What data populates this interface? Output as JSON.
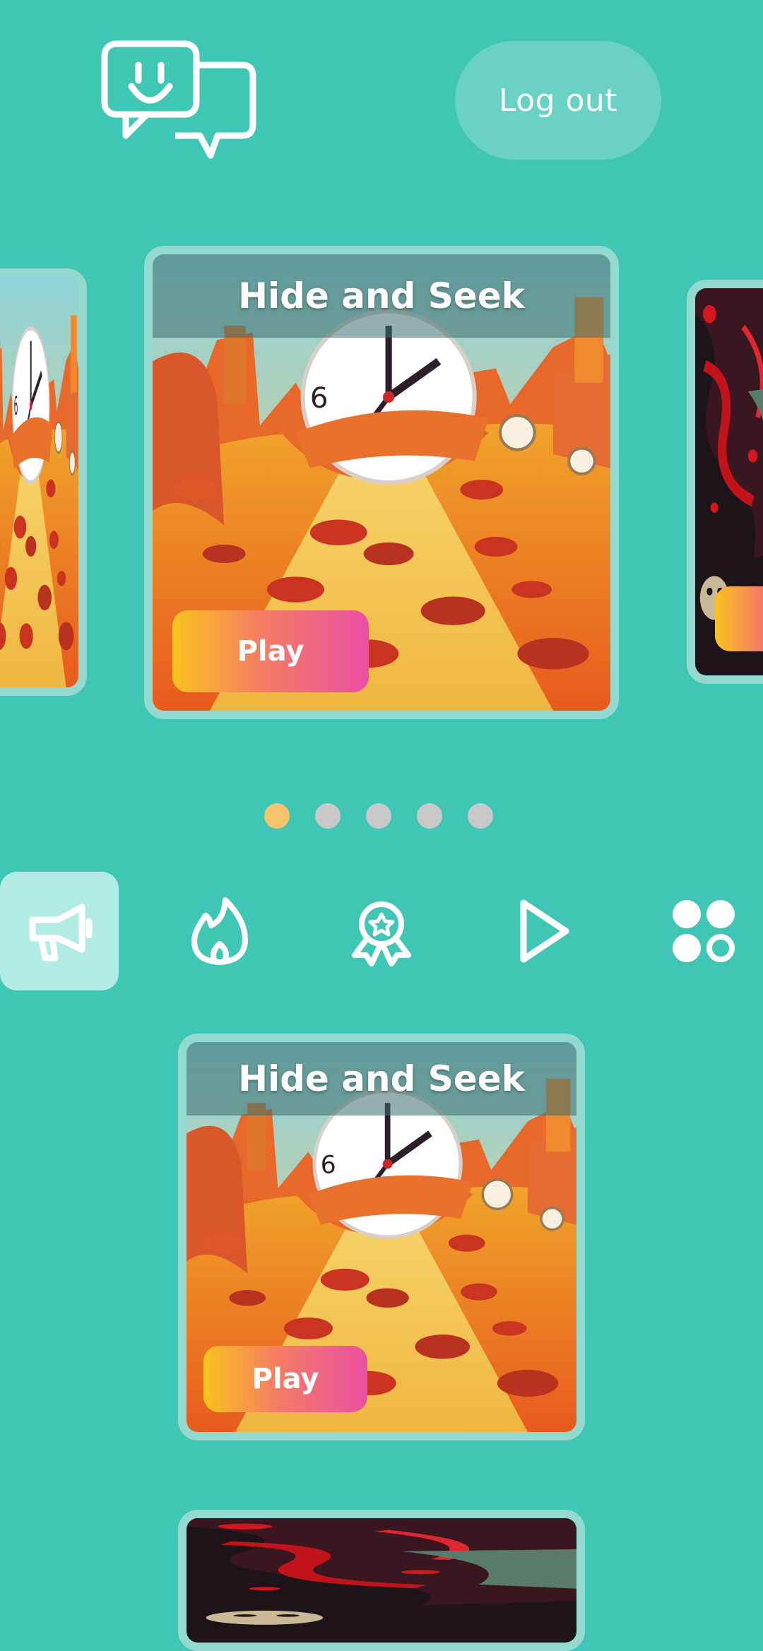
{
  "header": {
    "logo_icon": "chat-bubbles-smiley-icon",
    "logout_label": "Log out"
  },
  "carousel": {
    "cards": [
      {
        "title": "Hide and Seek",
        "play_label": "Play",
        "position": "center"
      },
      {
        "title": "",
        "play_label": "",
        "position": "left-peek"
      },
      {
        "title": "",
        "play_label": "",
        "position": "right-peek"
      }
    ],
    "page_count": 5,
    "active_page": 1
  },
  "tabs": [
    {
      "icon": "megaphone-icon",
      "active": true
    },
    {
      "icon": "flame-icon",
      "active": false
    },
    {
      "icon": "award-badge-icon",
      "active": false
    },
    {
      "icon": "play-icon",
      "active": false
    },
    {
      "icon": "grid-icon",
      "active": false
    }
  ],
  "list": {
    "cards": [
      {
        "title": "Hide and Seek",
        "play_label": "Play"
      }
    ]
  },
  "colors": {
    "background": "#3fc6b5",
    "card_border": "#92d9d0",
    "active_dot": "#f7c46e",
    "inactive_dot": "#c9c9c9",
    "play_gradient_start": "#f9c31e",
    "play_gradient_end": "#ea4fa2"
  }
}
